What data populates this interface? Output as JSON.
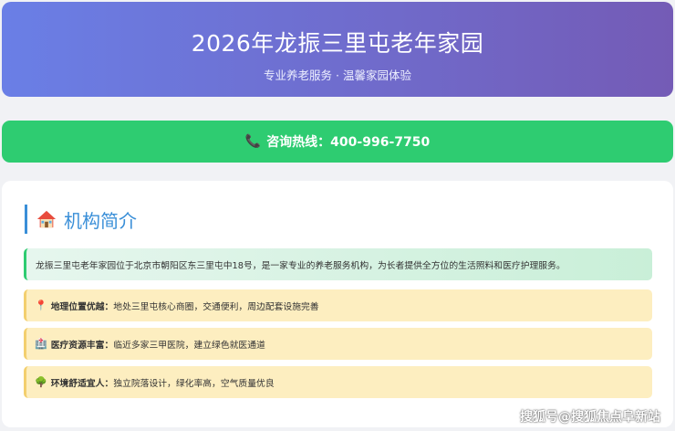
{
  "header": {
    "title": "2026年龙振三里屯老年家园",
    "subtitle": "专业养老服务 · 温馨家园体验"
  },
  "hotline": {
    "label": "咨询热线：400-996-7750"
  },
  "intro_section": {
    "title": "机构简介",
    "intro_text": "龙振三里屯老年家园位于北京市朝阳区东三里屯中18号，是一家专业的养老服务机构，为长者提供全方位的生活照料和医疗护理服务。",
    "features": [
      {
        "icon": "📍",
        "key": "地理位置优越：",
        "text": "地处三里屯核心商圈，交通便利，周边配套设施完善"
      },
      {
        "icon": "🏥",
        "key": "医疗资源丰富：",
        "text": "临近多家三甲医院，建立绿色就医通道"
      },
      {
        "icon": "🌳",
        "key": "环境舒适宜人：",
        "text": "独立院落设计，绿化率高，空气质量优良"
      }
    ]
  },
  "watermark": "搜狐号@搜狐焦点阜新站",
  "colors": {
    "header_gradient_start": "#6a7fe6",
    "header_gradient_end": "#745bb6",
    "hotline_green": "#2ecc71",
    "title_blue": "#3a8fd8",
    "feature_bg": "#fdeec0"
  }
}
